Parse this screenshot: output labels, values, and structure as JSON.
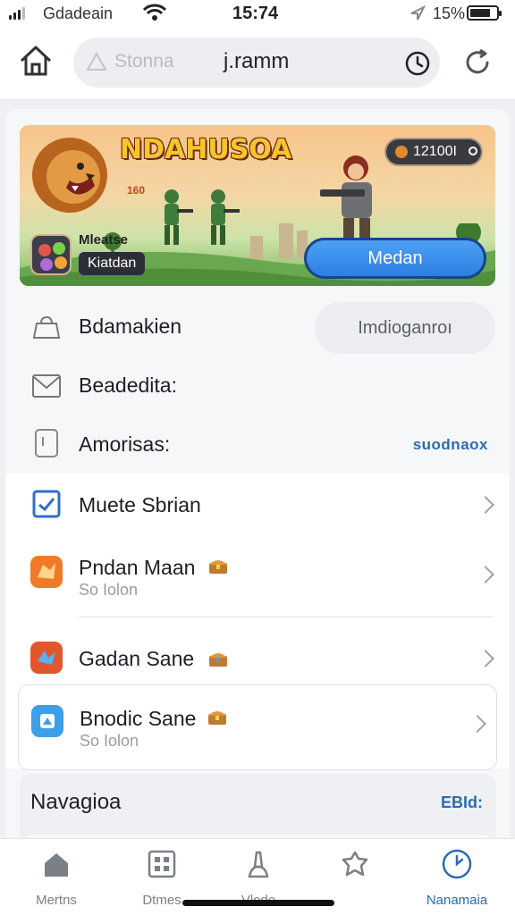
{
  "status_bar": {
    "carrier": "Gdadeain",
    "time": "15:74",
    "battery_text": "15%",
    "battery_level": 0.8
  },
  "browser": {
    "placeholder": "Stonna",
    "url": "j.ramm"
  },
  "banner": {
    "title": "NDAHUSOA",
    "small_score": "160",
    "coins": "12100I",
    "sub_line": "Mleatse",
    "sub_pill": "Kiatdan",
    "button": "Medan"
  },
  "settings": [
    {
      "label": "Bdamakien",
      "button": "Imdioganroı"
    },
    {
      "label": "Beadedita:"
    },
    {
      "label": "Amorisas:",
      "link": "suodnaox"
    }
  ],
  "list": [
    {
      "title": "Muete Sbrian"
    },
    {
      "title": "Pndan Maan",
      "subtitle": "So Iolon"
    },
    {
      "title": "Gadan Sane"
    },
    {
      "title": "Bnodic Sane",
      "subtitle": "So Iolon"
    }
  ],
  "navigation": {
    "title": "Navagioa",
    "link": "EBId:"
  },
  "tabs": [
    {
      "label": "Mertns",
      "icon": "home-icon"
    },
    {
      "label": "Dtmes",
      "icon": "grid-icon"
    },
    {
      "label": "Vlode",
      "icon": "cleaner-icon"
    },
    {
      "label": "Nanamaia",
      "icon": "clock-icon",
      "active": true
    }
  ],
  "colors": {
    "accent": "#2b6cb0",
    "banner_button": "#3a8ff0",
    "title_gold": "#f7c52a"
  }
}
